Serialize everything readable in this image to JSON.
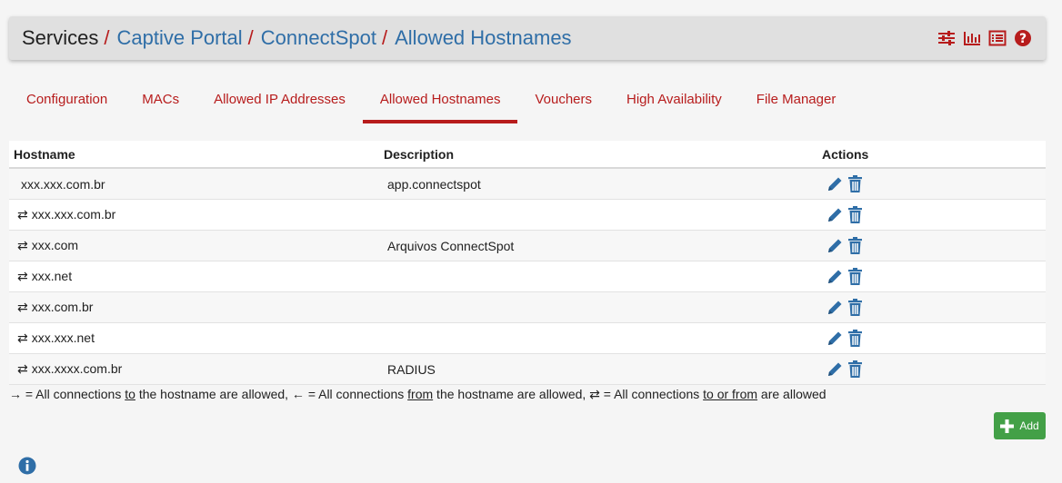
{
  "breadcrumb": {
    "root": "Services",
    "separator": "/",
    "links": [
      "Captive Portal",
      "ConnectSpot",
      "Allowed Hostnames"
    ]
  },
  "tabs": [
    {
      "label": "Configuration",
      "active": false
    },
    {
      "label": "MACs",
      "active": false
    },
    {
      "label": "Allowed IP Addresses",
      "active": false
    },
    {
      "label": "Allowed Hostnames",
      "active": true
    },
    {
      "label": "Vouchers",
      "active": false
    },
    {
      "label": "High Availability",
      "active": false
    },
    {
      "label": "File Manager",
      "active": false
    }
  ],
  "table": {
    "headers": {
      "hostname": "Hostname",
      "description": "Description",
      "actions": "Actions"
    },
    "rows": [
      {
        "direction": "",
        "hostname": "xxx.xxx.com.br",
        "description": "app.connectspot"
      },
      {
        "direction": "⇄",
        "hostname": "xxx.xxx.com.br",
        "description": ""
      },
      {
        "direction": "⇄",
        "hostname": "xxx.com",
        "description": "Arquivos ConnectSpot"
      },
      {
        "direction": "⇄",
        "hostname": "xxx.net",
        "description": ""
      },
      {
        "direction": "⇄",
        "hostname": "xxx.com.br",
        "description": ""
      },
      {
        "direction": "⇄",
        "hostname": "xxx.xxx.net",
        "description": ""
      },
      {
        "direction": "⇄",
        "hostname": "xxx.xxxx.com.br",
        "description": "RADIUS"
      }
    ]
  },
  "legend": {
    "p1": "→ = All connections ",
    "u1": "to",
    "p2": " the hostname are allowed, ← = All connections ",
    "u2": "from",
    "p3": " the hostname are allowed, ⇄ = All connections ",
    "u3": "to or from",
    "p4": " are allowed"
  },
  "add_button": {
    "label": "Add"
  },
  "colors": {
    "accent": "#b71c1c",
    "link": "#2f6ea7",
    "action_icon": "#2f6ea7",
    "add": "#43a047",
    "header_bg": "#e0e0e0"
  },
  "icons": {
    "header": [
      "sliders-icon",
      "bar-chart-icon",
      "list-icon",
      "help-icon"
    ],
    "row_actions": [
      "pencil-icon",
      "trash-icon"
    ],
    "add": "plus-icon",
    "info": "info-icon"
  }
}
